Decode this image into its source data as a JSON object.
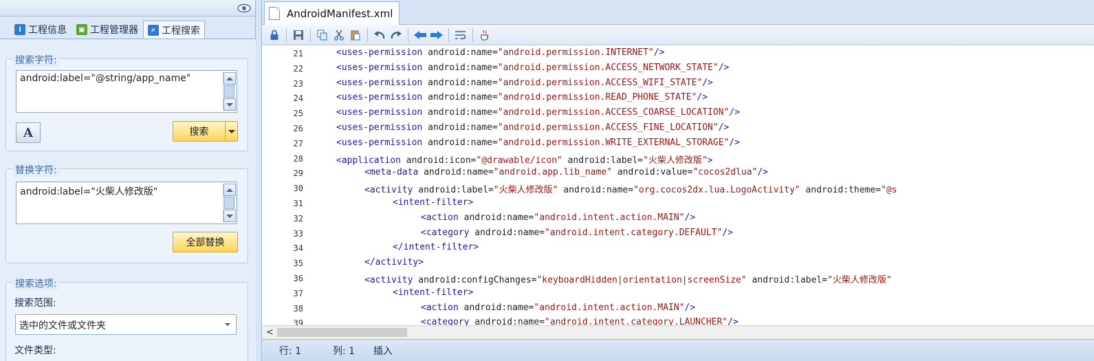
{
  "left_panel": {
    "tabs": [
      {
        "label": "工程信息",
        "icon": "info-icon",
        "color": "#2f7bd1"
      },
      {
        "label": "工程管理器",
        "icon": "android-icon",
        "color": "#5aa52a"
      },
      {
        "label": "工程搜索",
        "icon": "search-icon",
        "color": "#2f7bd1"
      }
    ],
    "search": {
      "title": "搜索字符:",
      "value": "android:label=\"@string/app_name\"",
      "button_label": "搜索",
      "font_button": "A"
    },
    "replace": {
      "title": "替换字符:",
      "value": "android:label=\"火柴人修改版\"",
      "button_label": "全部替换"
    },
    "options": {
      "title": "搜索选项:",
      "scope_label": "搜索范围:",
      "scope_value": "选中的文件或文件夹",
      "filetype_label": "文件类型:"
    }
  },
  "editor": {
    "tab_title": "AndroidManifest.xml",
    "lines": [
      {
        "num": "21",
        "indent": 0,
        "tokens": [
          [
            "tg",
            "<uses-permission "
          ],
          [
            "an",
            "android:name="
          ],
          [
            "av",
            "\"android.permission.INTERNET\""
          ],
          [
            "tg",
            "/>"
          ]
        ]
      },
      {
        "num": "22",
        "indent": 0,
        "tokens": [
          [
            "tg",
            "<uses-permission "
          ],
          [
            "an",
            "android:name="
          ],
          [
            "av",
            "\"android.permission.ACCESS_NETWORK_STATE\""
          ],
          [
            "tg",
            "/>"
          ]
        ]
      },
      {
        "num": "23",
        "indent": 0,
        "tokens": [
          [
            "tg",
            "<uses-permission "
          ],
          [
            "an",
            "android:name="
          ],
          [
            "av",
            "\"android.permission.ACCESS_WIFI_STATE\""
          ],
          [
            "tg",
            "/>"
          ]
        ]
      },
      {
        "num": "24",
        "indent": 0,
        "tokens": [
          [
            "tg",
            "<uses-permission "
          ],
          [
            "an",
            "android:name="
          ],
          [
            "av",
            "\"android.permission.READ_PHONE_STATE\""
          ],
          [
            "tg",
            "/>"
          ]
        ]
      },
      {
        "num": "25",
        "indent": 0,
        "tokens": [
          [
            "tg",
            "<uses-permission "
          ],
          [
            "an",
            "android:name="
          ],
          [
            "av",
            "\"android.permission.ACCESS_COARSE_LOCATION\""
          ],
          [
            "tg",
            "/>"
          ]
        ]
      },
      {
        "num": "26",
        "indent": 0,
        "tokens": [
          [
            "tg",
            "<uses-permission "
          ],
          [
            "an",
            "android:name="
          ],
          [
            "av",
            "\"android.permission.ACCESS_FINE_LOCATION\""
          ],
          [
            "tg",
            "/>"
          ]
        ]
      },
      {
        "num": "27",
        "indent": 0,
        "tokens": [
          [
            "tg",
            "<uses-permission "
          ],
          [
            "an",
            "android:name="
          ],
          [
            "av",
            "\"android.permission.WRITE_EXTERNAL_STORAGE\""
          ],
          [
            "tg",
            "/>"
          ]
        ]
      },
      {
        "num": "28",
        "indent": 0,
        "tokens": [
          [
            "tg",
            "<application "
          ],
          [
            "an",
            "android:icon="
          ],
          [
            "av",
            "\"@drawable/icon\""
          ],
          [
            "an",
            " android:label="
          ],
          [
            "av",
            "\"火柴人修改版\""
          ],
          [
            "tg",
            ">"
          ]
        ]
      },
      {
        "num": "29",
        "indent": 1,
        "tokens": [
          [
            "tg",
            "<meta-data "
          ],
          [
            "an",
            "android:name="
          ],
          [
            "av",
            "\"android.app.lib_name\""
          ],
          [
            "an",
            " android:value="
          ],
          [
            "av",
            "\"cocos2dlua\""
          ],
          [
            "tg",
            "/>"
          ]
        ]
      },
      {
        "num": "30",
        "indent": 1,
        "tokens": [
          [
            "tg",
            "<activity "
          ],
          [
            "an",
            "android:label="
          ],
          [
            "av",
            "\"火柴人修改版\""
          ],
          [
            "an",
            " android:name="
          ],
          [
            "av",
            "\"org.cocos2dx.lua.LogoActivity\""
          ],
          [
            "an",
            " android:theme="
          ],
          [
            "av",
            "\"@s"
          ]
        ]
      },
      {
        "num": "31",
        "indent": 2,
        "tokens": [
          [
            "tg",
            "<intent-filter>"
          ]
        ]
      },
      {
        "num": "32",
        "indent": 3,
        "tokens": [
          [
            "tg",
            "<action "
          ],
          [
            "an",
            "android:name="
          ],
          [
            "av",
            "\"android.intent.action.MAIN\""
          ],
          [
            "tg",
            "/>"
          ]
        ]
      },
      {
        "num": "33",
        "indent": 3,
        "tokens": [
          [
            "tg",
            "<category "
          ],
          [
            "an",
            "android:name="
          ],
          [
            "av",
            "\"android.intent.category.DEFAULT\""
          ],
          [
            "tg",
            "/>"
          ]
        ]
      },
      {
        "num": "34",
        "indent": 2,
        "tokens": [
          [
            "tg",
            "</intent-filter>"
          ]
        ]
      },
      {
        "num": "35",
        "indent": 1,
        "tokens": [
          [
            "tg",
            "</activity>"
          ]
        ]
      },
      {
        "num": "36",
        "indent": 1,
        "tokens": [
          [
            "tg",
            "<activity "
          ],
          [
            "an",
            "android:configChanges="
          ],
          [
            "av",
            "\"keyboardHidden|orientation|screenSize\""
          ],
          [
            "an",
            " android:label="
          ],
          [
            "av",
            "\"火柴人修改版\""
          ]
        ]
      },
      {
        "num": "37",
        "indent": 2,
        "tokens": [
          [
            "tg",
            "<intent-filter>"
          ]
        ]
      },
      {
        "num": "38",
        "indent": 3,
        "tokens": [
          [
            "tg",
            "<action "
          ],
          [
            "an",
            "android:name="
          ],
          [
            "av",
            "\"android.intent.action.MAIN\""
          ],
          [
            "tg",
            "/>"
          ]
        ]
      },
      {
        "num": "39",
        "indent": 3,
        "tokens": [
          [
            "tg",
            "<category "
          ],
          [
            "an",
            "android:name="
          ],
          [
            "av",
            "\"android.intent.category.LAUNCHER\""
          ],
          [
            "tg",
            "/>"
          ]
        ]
      }
    ],
    "status": {
      "row": "行: 1",
      "col": "列: 1",
      "mode": "插入"
    },
    "scroll_left": "<"
  },
  "colors": {
    "accent": "#2f7bd1",
    "tag": "#1a1aa6",
    "attr_value": "#a31515",
    "button_yellow": "#ffd45a"
  }
}
